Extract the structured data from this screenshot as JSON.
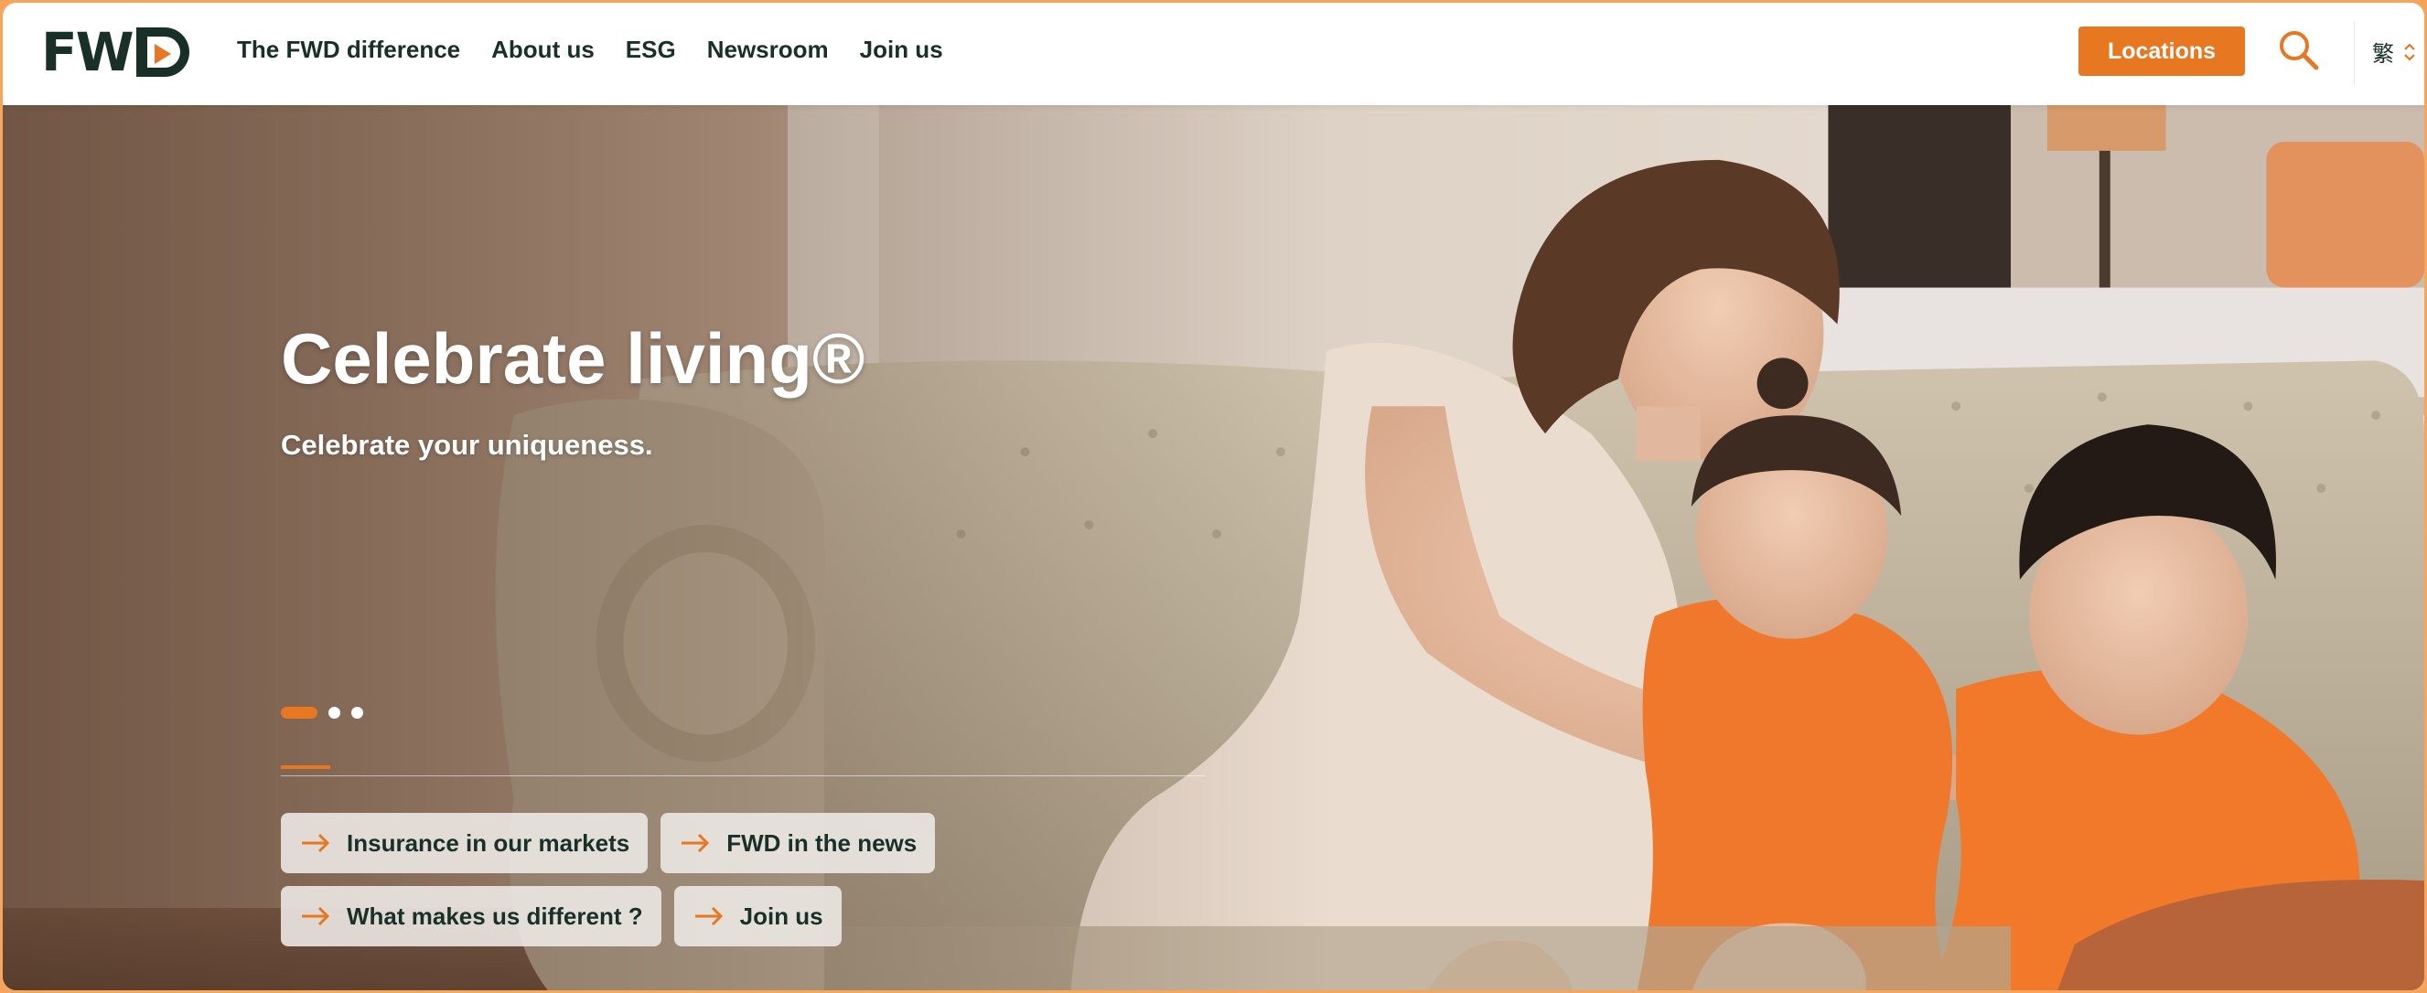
{
  "brand": {
    "logo_text": "FW",
    "accent": "#e87722",
    "ink": "#183028"
  },
  "nav": {
    "items": [
      {
        "label": "The FWD difference"
      },
      {
        "label": "About us"
      },
      {
        "label": "ESG"
      },
      {
        "label": "Newsroom"
      },
      {
        "label": "Join us"
      }
    ]
  },
  "header": {
    "locations_label": "Locations",
    "search_icon": "search-icon",
    "language": {
      "selected": "繁"
    }
  },
  "hero": {
    "title": "Celebrate living®",
    "subtitle": "Celebrate your uniqueness.",
    "carousel": {
      "total_slides": 3,
      "active_index": 0
    },
    "quick_links": [
      {
        "label": "Insurance in our markets",
        "icon": "arrow-right-icon"
      },
      {
        "label": "FWD in the news",
        "icon": "arrow-right-icon"
      },
      {
        "label": "What makes us different ?",
        "icon": "arrow-right-icon"
      },
      {
        "label": "Join us",
        "icon": "arrow-right-icon"
      }
    ]
  }
}
